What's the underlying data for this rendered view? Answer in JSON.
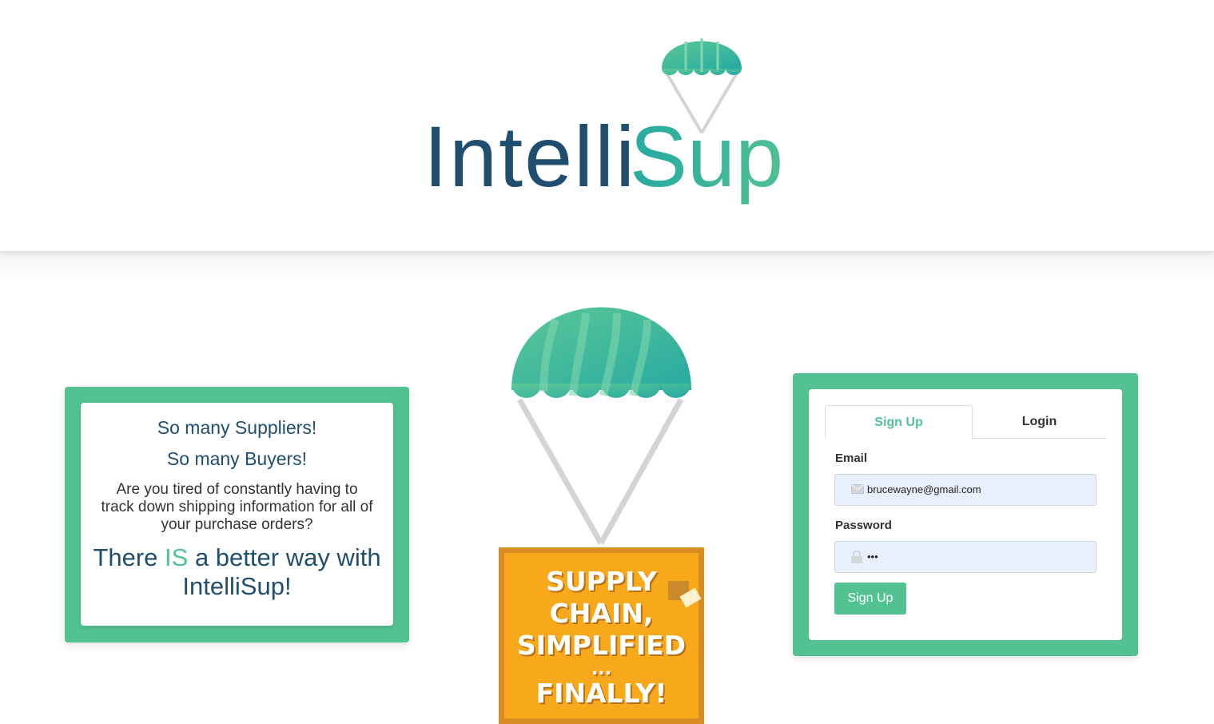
{
  "header": {
    "logo_text_part1": "Intelli",
    "logo_text_part2": "Sup",
    "colors": {
      "dark_blue": "#1f4e6e",
      "green": "#52c293",
      "teal": "#27aaa2"
    }
  },
  "info_card": {
    "line1": "So many Suppliers!",
    "line2": "So many Buyers!",
    "paragraph": "Are you tired of constantly having to track down shipping information for all of your purchase orders?",
    "tagline_part1": "There ",
    "tagline_emphasis": "IS",
    "tagline_part2": " a better way with IntelliSup!"
  },
  "crate": {
    "line1": "SUPPLY",
    "line2": "CHAIN,",
    "line3": "SIMPLIFIED",
    "dots": "...",
    "line4": "FINALLY!"
  },
  "form": {
    "tabs": [
      {
        "label": "Sign Up",
        "active": true
      },
      {
        "label": "Login",
        "active": false
      }
    ],
    "email_label": "Email",
    "email_value": "brucewayne@gmail.com",
    "password_label": "Password",
    "password_value": "•••",
    "submit_label": "Sign Up",
    "icons": {
      "email": "envelope-icon",
      "password": "lock-icon"
    }
  }
}
